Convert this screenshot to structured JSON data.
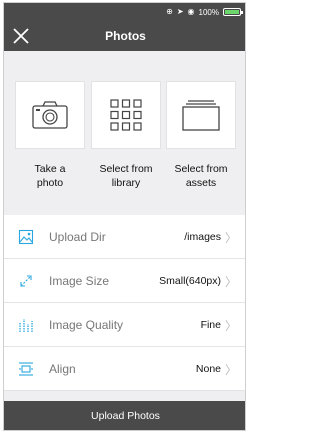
{
  "status": {
    "battery_text": "100%"
  },
  "nav": {
    "title": "Photos"
  },
  "tiles": [
    {
      "label_line1": "Take a",
      "label_line2": "photo"
    },
    {
      "label_line1": "Select from",
      "label_line2": "library"
    },
    {
      "label_line1": "Select from",
      "label_line2": "assets"
    }
  ],
  "settings": [
    {
      "label": "Upload Dir",
      "value": "/images",
      "icon": "folder-image-icon"
    },
    {
      "label": "Image Size",
      "value": "Small(640px)",
      "icon": "resize-icon"
    },
    {
      "label": "Image Quality",
      "value": "Fine",
      "icon": "quality-bars-icon"
    },
    {
      "label": "Align",
      "value": "None",
      "icon": "align-icon"
    }
  ],
  "footer": {
    "upload_label": "Upload Photos"
  },
  "colors": {
    "bar": "#4a4a4a",
    "accent": "#2aa7e0",
    "background": "#efeff1"
  }
}
